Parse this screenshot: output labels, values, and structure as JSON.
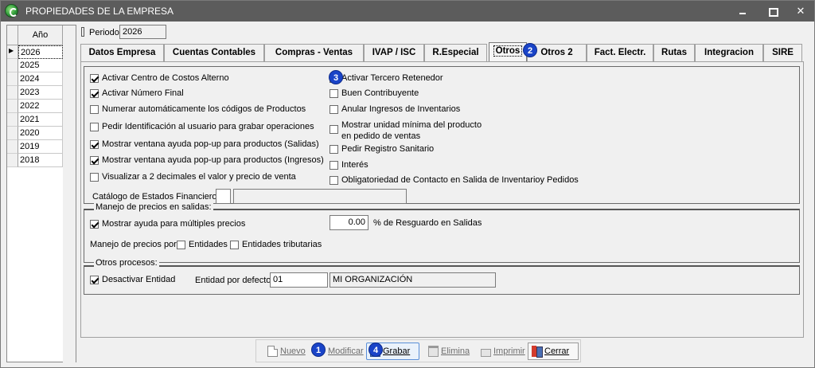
{
  "window": {
    "title": "PROPIEDADES DE LA EMPRESA"
  },
  "years": {
    "header": "Año",
    "items": [
      "2026",
      "2025",
      "2024",
      "2023",
      "2022",
      "2021",
      "2020",
      "2019",
      "2018"
    ],
    "selected": "2026"
  },
  "periodo": {
    "label": "Periodo",
    "value": "2026"
  },
  "tabs": [
    {
      "label": "Datos Empresa"
    },
    {
      "label": "Cuentas Contables"
    },
    {
      "label": "Compras - Ventas"
    },
    {
      "label": "IVAP / ISC"
    },
    {
      "label": "R.Especial"
    },
    {
      "label": "Otros",
      "active": true
    },
    {
      "label": "Otros 2"
    },
    {
      "label": "Fact. Electr."
    },
    {
      "label": "Rutas"
    },
    {
      "label": "Integracion"
    },
    {
      "label": "SIRE"
    }
  ],
  "left_options": [
    {
      "label": "Activar Centro de Costos Alterno",
      "checked": true
    },
    {
      "label": "Activar Número Final",
      "checked": true
    },
    {
      "label": "Numerar automáticamente los códigos de Productos",
      "checked": false
    },
    {
      "label": "Pedir Identificación al usuario para grabar operaciones",
      "checked": false
    },
    {
      "label": "Mostrar ventana ayuda pop-up para productos (Salidas)",
      "checked": true
    },
    {
      "label": "Mostrar ventana ayuda pop-up para productos (Ingresos)",
      "checked": true
    },
    {
      "label": "Visualizar a 2 decimales el valor y precio de venta",
      "checked": false
    }
  ],
  "right_options": [
    {
      "label": "Activar Tercero Retenedor",
      "checked": false
    },
    {
      "label": "Buen Contribuyente",
      "checked": false
    },
    {
      "label": "Anular Ingresos de Inventarios",
      "checked": false
    },
    {
      "label": "Mostrar unidad mínima del producto en pedido de ventas",
      "checked": false
    },
    {
      "label": "Pedir Registro Sanitario",
      "checked": false
    },
    {
      "label": "Interés",
      "checked": false
    },
    {
      "label": "Obligatoriedad de Contacto en Salida de  Inventarioy Pedidos",
      "checked": false
    }
  ],
  "catalogo": {
    "label": "Catálogo de Estados Financieros",
    "code": "",
    "description": ""
  },
  "manejo_precios": {
    "title": "Manejo de precios en salidas:",
    "mostrar_ayuda": {
      "label": "Mostrar ayuda para múltiples precios",
      "checked": true
    },
    "resguardo_value": "0.00",
    "resguardo_label": "% de Resguardo en Salidas",
    "por_label": "Manejo de precios por:",
    "entidades": {
      "label": "Entidades",
      "checked": false
    },
    "entidades_tributarias": {
      "label": "Entidades tributarias",
      "checked": false
    }
  },
  "otros_procesos": {
    "title": "Otros procesos:",
    "desactivar": {
      "label": "Desactivar Entidad",
      "checked": true
    },
    "entidad_label": "Entidad por defecto",
    "entidad_code": "01",
    "entidad_name": "MI ORGANIZACIÓN"
  },
  "toolbar": {
    "nuevo": "Nuevo",
    "modificar": "Modificar",
    "grabar": "Grabar",
    "elimina": "Elimina",
    "imprimir": "Imprimir",
    "cerrar": "Cerrar"
  },
  "badges": [
    "1",
    "2",
    "3",
    "4"
  ]
}
